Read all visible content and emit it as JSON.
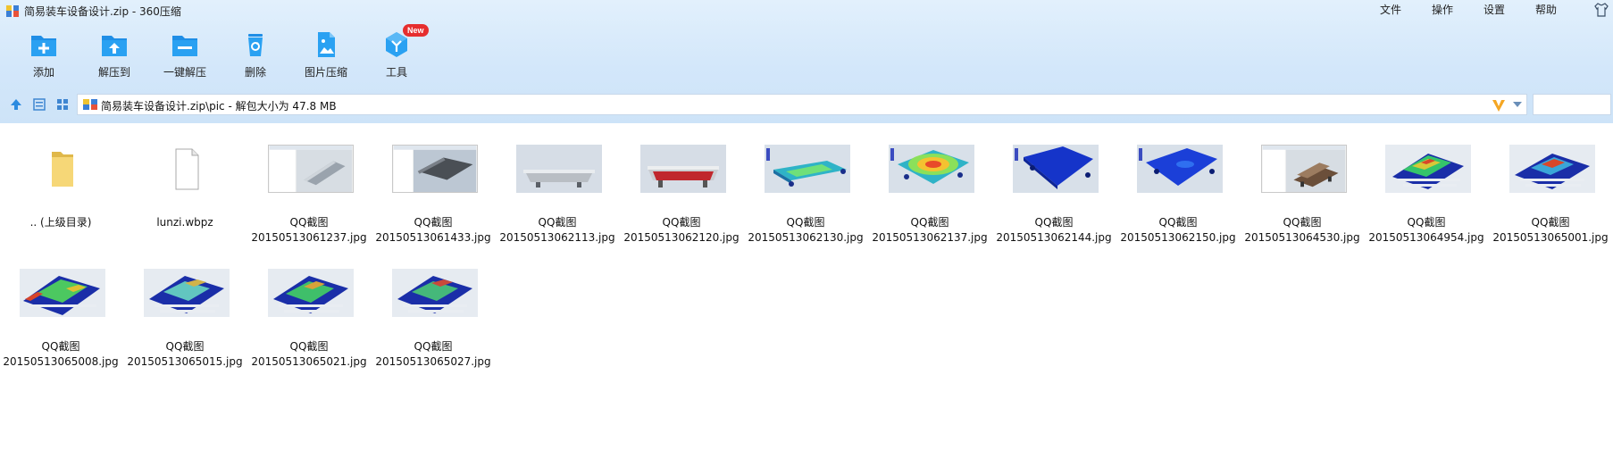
{
  "window": {
    "title": "简易装车设备设计.zip - 360压缩"
  },
  "menu": [
    "文件",
    "操作",
    "设置",
    "帮助"
  ],
  "toolbar": {
    "add": "添加",
    "extract_to": "解压到",
    "one_click_extract": "一键解压",
    "delete": "删除",
    "image_compress": "图片压缩",
    "tools": "工具",
    "new_badge": "New"
  },
  "address": {
    "path": "简易装车设备设计.zip\\pic - 解包大小为 47.8 MB"
  },
  "files": [
    {
      "line1": ".. (上级目录)",
      "line2": "",
      "kind": "folder"
    },
    {
      "line1": "lunzi.wbpz",
      "line2": "",
      "kind": "doc"
    },
    {
      "line1": "QQ截图",
      "line2": "20150513061237.jpg",
      "kind": "shot-window"
    },
    {
      "line1": "QQ截图",
      "line2": "20150513061433.jpg",
      "kind": "shot-window-dark"
    },
    {
      "line1": "QQ截图",
      "line2": "20150513062113.jpg",
      "kind": "gray-plate"
    },
    {
      "line1": "QQ截图",
      "line2": "20150513062120.jpg",
      "kind": "red-plate"
    },
    {
      "line1": "QQ截图",
      "line2": "20150513062130.jpg",
      "kind": "stress-flat"
    },
    {
      "line1": "QQ截图",
      "line2": "20150513062137.jpg",
      "kind": "stress-hot"
    },
    {
      "line1": "QQ截图",
      "line2": "20150513062144.jpg",
      "kind": "blue-plate"
    },
    {
      "line1": "QQ截图",
      "line2": "20150513062150.jpg",
      "kind": "blue-plate-2"
    },
    {
      "line1": "QQ截图",
      "line2": "20150513064530.jpg",
      "kind": "shot-window-brown"
    },
    {
      "line1": "QQ截图",
      "line2": "20150513064954.jpg",
      "kind": "frame"
    },
    {
      "line1": "QQ截图",
      "line2": "20150513065001.jpg",
      "kind": "frame"
    },
    {
      "line1": "QQ截图",
      "line2": "20150513065008.jpg",
      "kind": "frame"
    },
    {
      "line1": "QQ截图",
      "line2": "20150513065015.jpg",
      "kind": "frame"
    },
    {
      "line1": "QQ截图",
      "line2": "20150513065021.jpg",
      "kind": "frame"
    },
    {
      "line1": "QQ截图",
      "line2": "20150513065027.jpg",
      "kind": "frame"
    }
  ]
}
